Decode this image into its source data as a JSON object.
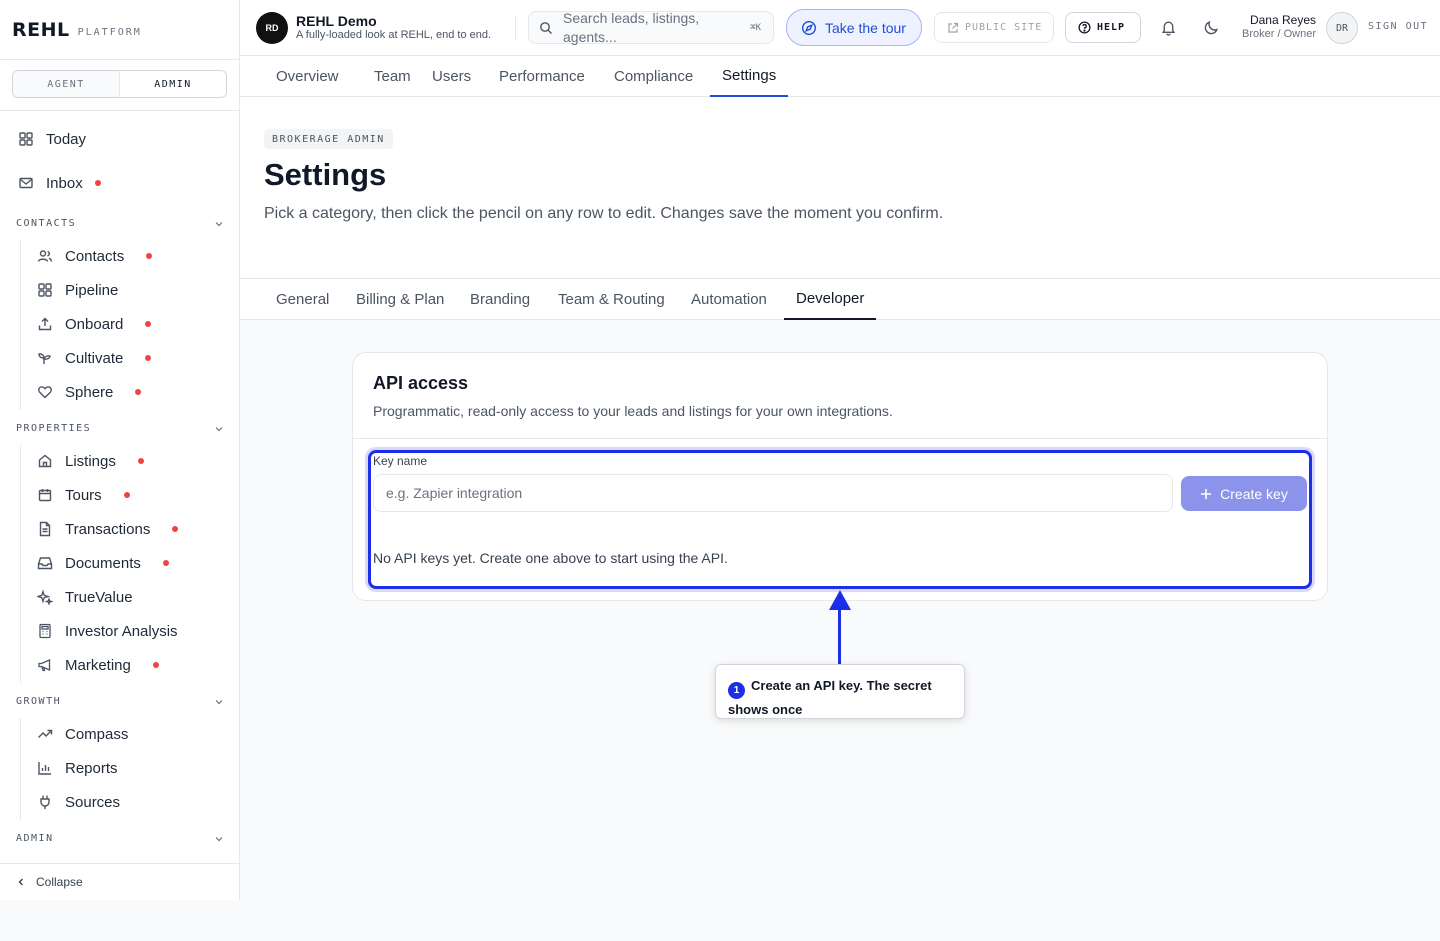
{
  "brand": {
    "name": "REHL",
    "sub": "PLATFORM"
  },
  "mode": {
    "options": [
      "AGENT",
      "ADMIN"
    ],
    "selected": "ADMIN"
  },
  "sidebar": {
    "top_items": [
      {
        "label": "Today",
        "icon": "grid-icon"
      },
      {
        "label": "Inbox",
        "icon": "mail-icon",
        "dot": true
      }
    ],
    "sections": [
      {
        "title": "CONTACTS",
        "items": [
          {
            "label": "Contacts",
            "icon": "users-icon",
            "dot": true
          },
          {
            "label": "Pipeline",
            "icon": "grid-icon",
            "dot": false
          },
          {
            "label": "Onboard",
            "icon": "upload-icon",
            "dot": true
          },
          {
            "label": "Cultivate",
            "icon": "sprout-icon",
            "dot": true
          },
          {
            "label": "Sphere",
            "icon": "heart-icon",
            "dot": true
          }
        ]
      },
      {
        "title": "PROPERTIES",
        "items": [
          {
            "label": "Listings",
            "icon": "home-icon",
            "dot": true
          },
          {
            "label": "Tours",
            "icon": "calendar-icon",
            "dot": true
          },
          {
            "label": "Transactions",
            "icon": "file-icon",
            "dot": true
          },
          {
            "label": "Documents",
            "icon": "inbox-icon",
            "dot": true
          },
          {
            "label": "TrueValue",
            "icon": "sparkles-icon",
            "dot": false
          },
          {
            "label": "Investor Analysis",
            "icon": "calculator-icon",
            "dot": false
          },
          {
            "label": "Marketing",
            "icon": "megaphone-icon",
            "dot": true
          }
        ]
      },
      {
        "title": "GROWTH",
        "items": [
          {
            "label": "Compass",
            "icon": "trending-icon",
            "dot": false
          },
          {
            "label": "Reports",
            "icon": "bar-chart-icon",
            "dot": false
          },
          {
            "label": "Sources",
            "icon": "plug-icon",
            "dot": false
          }
        ]
      },
      {
        "title": "ADMIN",
        "items": []
      }
    ],
    "collapse_label": "Collapse"
  },
  "header": {
    "org_initials": "RD",
    "org_name": "REHL Demo",
    "org_desc": "A fully-loaded look at REHL, end to end.",
    "search_placeholder": "Search leads, listings, agents...",
    "search_shortcut": "⌘K",
    "tour_label": "Take the tour",
    "public_site_label": "PUBLIC SITE",
    "help_label": "HELP",
    "user_name": "Dana Reyes",
    "user_role": "Broker / Owner",
    "user_initials": "DR",
    "signout_label": "SIGN OUT"
  },
  "admin_tabs": {
    "items": [
      "Overview",
      "Team",
      "Users",
      "Performance",
      "Compliance",
      "Settings"
    ],
    "active": "Settings"
  },
  "page": {
    "eyebrow": "BROKERAGE ADMIN",
    "title": "Settings",
    "description": "Pick a category, then click the pencil on any row to edit. Changes save the moment you confirm."
  },
  "settings_tabs": {
    "items": [
      "General",
      "Billing & Plan",
      "Branding",
      "Team & Routing",
      "Automation",
      "Developer"
    ],
    "active": "Developer"
  },
  "api_card": {
    "title": "API access",
    "description": "Programmatic, read-only access to your leads and listings for your own integrations.",
    "key_name_label": "Key name",
    "key_name_placeholder": "e.g. Zapier integration",
    "key_name_value": "",
    "create_button": "Create key",
    "empty_message": "No API keys yet. Create one above to start using the API."
  },
  "tour": {
    "step": "1",
    "text": "Create an API key. The secret shows once"
  },
  "colors": {
    "accent": "#1d2ee8",
    "dot": "#ef4444",
    "create_button": "#8b93ea"
  }
}
